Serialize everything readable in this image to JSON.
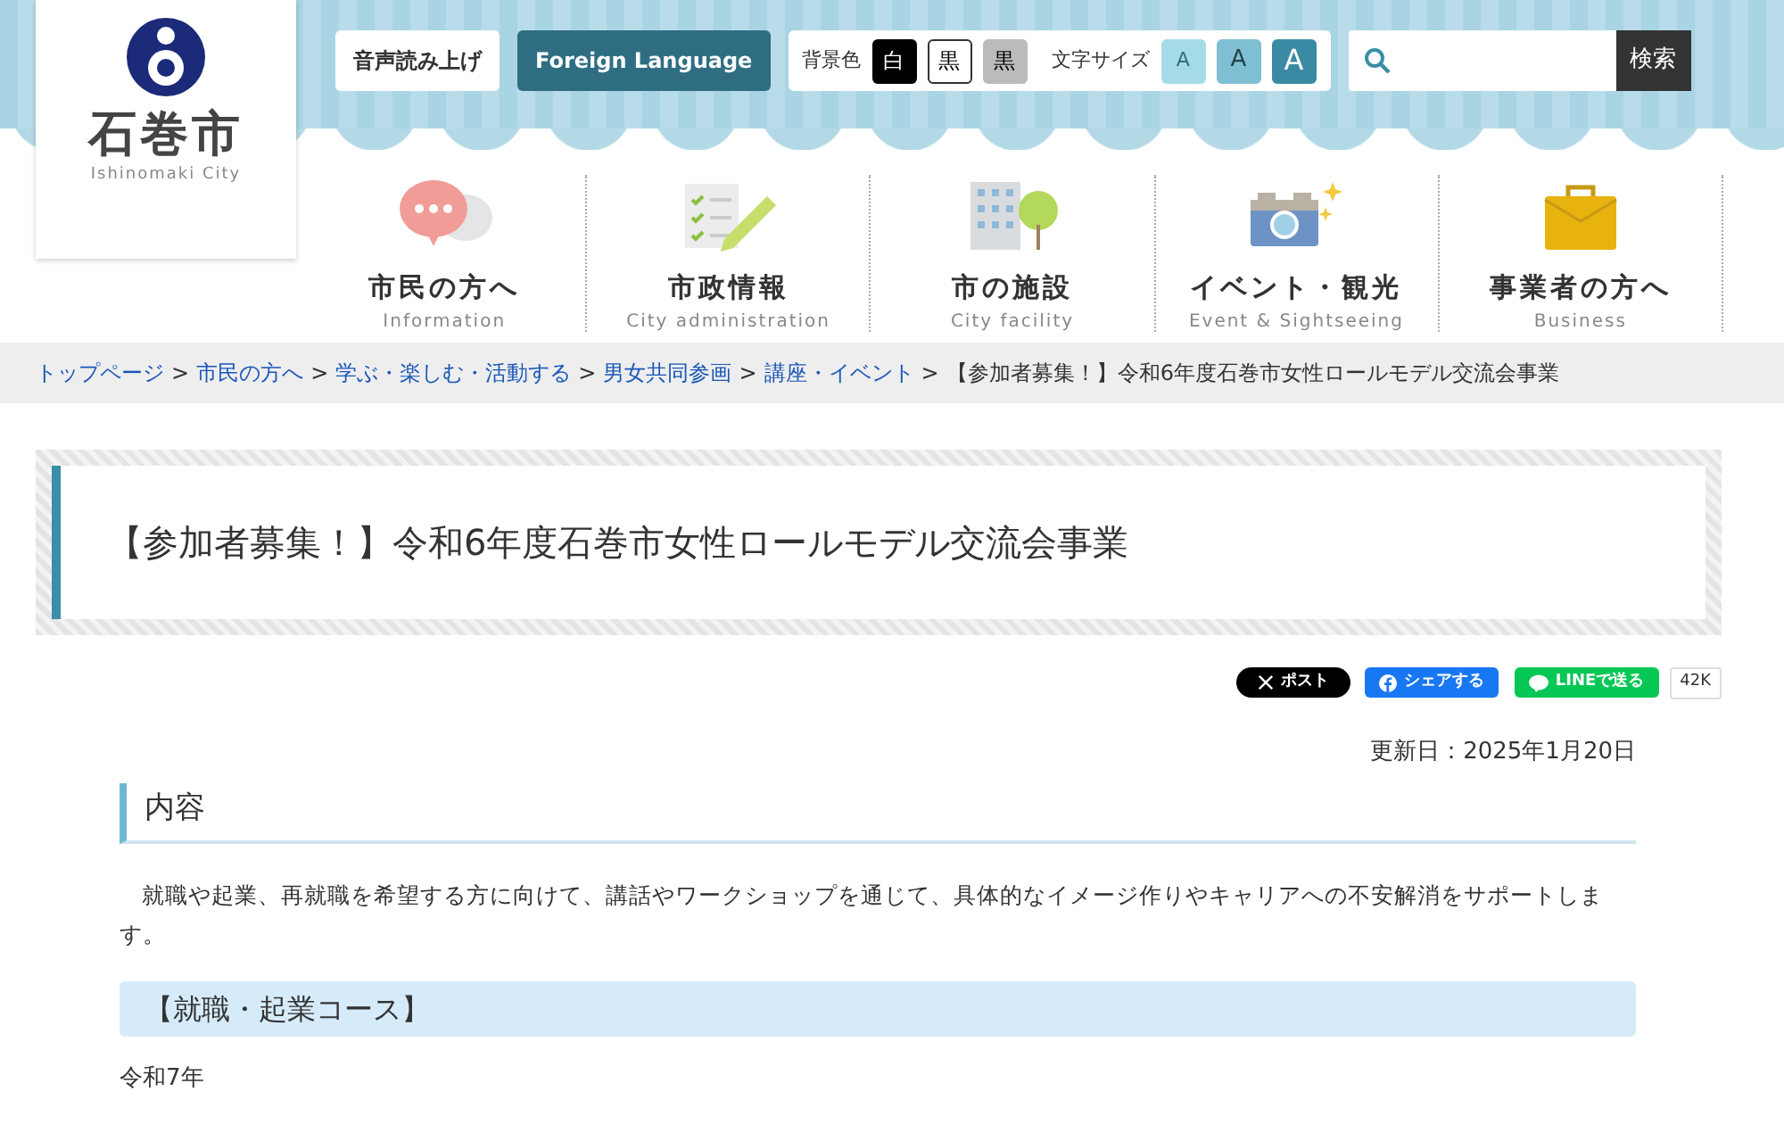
{
  "logo": {
    "name": "石巻市",
    "roman": "Ishinomaki City"
  },
  "tools": {
    "read_aloud": "音声読み上げ",
    "foreign": "Foreign Language",
    "bg_label": "背景色",
    "bg_options": [
      "白",
      "黒",
      "黒"
    ],
    "size_label": "文字サイズ",
    "size_options": [
      "A",
      "A",
      "A"
    ],
    "search_button": "検索"
  },
  "nav": [
    {
      "label": "市民の方へ",
      "sub": "Information",
      "kind": "chat"
    },
    {
      "label": "市政情報",
      "sub": "City administration",
      "kind": "doc"
    },
    {
      "label": "市の施設",
      "sub": "City facility",
      "kind": "building"
    },
    {
      "label": "イベント・観光",
      "sub": "Event & Sightseeing",
      "kind": "camera"
    },
    {
      "label": "事業者の方へ",
      "sub": "Business",
      "kind": "briefcase"
    }
  ],
  "breadcrumb": {
    "links": [
      {
        "label": "トップページ",
        "separator": ">"
      },
      {
        "label": "市民の方へ",
        "separator": ">"
      },
      {
        "label": "学ぶ・楽しむ・活動する",
        "separator": ">"
      },
      {
        "label": "男女共同参画",
        "separator": ">"
      },
      {
        "label": "講座・イベント",
        "separator": ">"
      }
    ],
    "current": "【参加者募集！】令和6年度石巻市女性ロールモデル交流会事業"
  },
  "title": "【参加者募集！】令和6年度石巻市女性ロールモデル交流会事業",
  "share": {
    "x": "ポスト",
    "facebook": "シェアする",
    "line": "LINEで送る",
    "count": "42K"
  },
  "updated": "更新日：2025年1月20日",
  "section_heading": "内容",
  "body": "就職や起業、再就職を希望する方に向けて、講話やワークショップを通じて、具体的なイメージ作りやキャリアへの不安解消をサポートします。",
  "course_heading": "【就職・起業コース】",
  "year": "令和7年"
}
